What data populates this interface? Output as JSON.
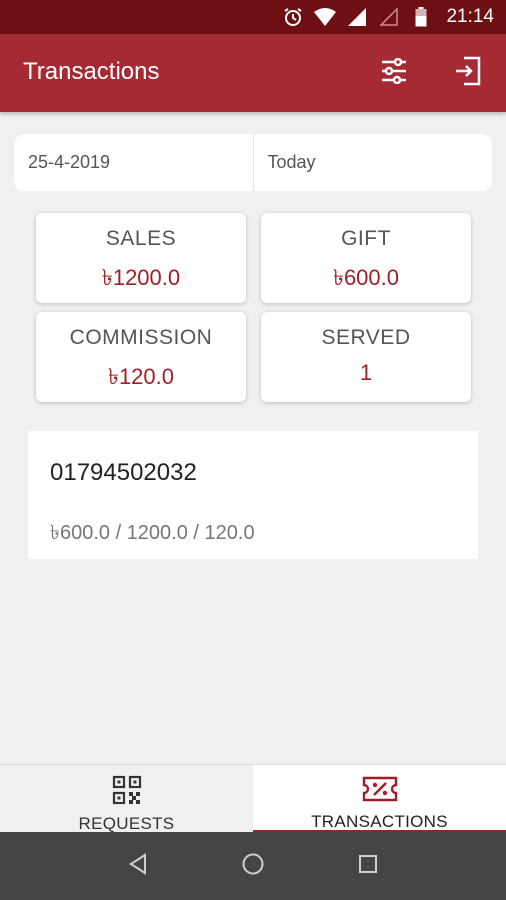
{
  "status_bar": {
    "time": "21:14",
    "icons": [
      "alarm-icon",
      "wifi-icon",
      "signal-icon",
      "signal-empty-icon",
      "battery-icon"
    ]
  },
  "app_bar": {
    "title": "Transactions",
    "actions": [
      "filter-sliders-icon",
      "logout-icon"
    ],
    "background": "#a52a34"
  },
  "date_filter": {
    "date": "25-4-2019",
    "period": "Today"
  },
  "stats": {
    "sales": {
      "label": "SALES",
      "value": "৳1200.0"
    },
    "gift": {
      "label": "GIFT",
      "value": "৳600.0"
    },
    "commission": {
      "label": "COMMISSION",
      "value": "৳120.0"
    },
    "served": {
      "label": "SERVED",
      "value": "1"
    }
  },
  "transactions": [
    {
      "phone": "01794502032",
      "amounts": "৳600.0 / 1200.0 / 120.0"
    }
  ],
  "bottom_nav": {
    "tabs": [
      {
        "label": "REQUESTS",
        "icon": "qr-code-icon",
        "active": false
      },
      {
        "label": "TRANSACTIONS",
        "icon": "discount-ticket-icon",
        "active": true
      }
    ]
  },
  "system_nav": [
    "back-icon",
    "home-icon",
    "recents-icon"
  ],
  "colors": {
    "accent": "#a01e28",
    "status_bar": "#6e0f14"
  }
}
